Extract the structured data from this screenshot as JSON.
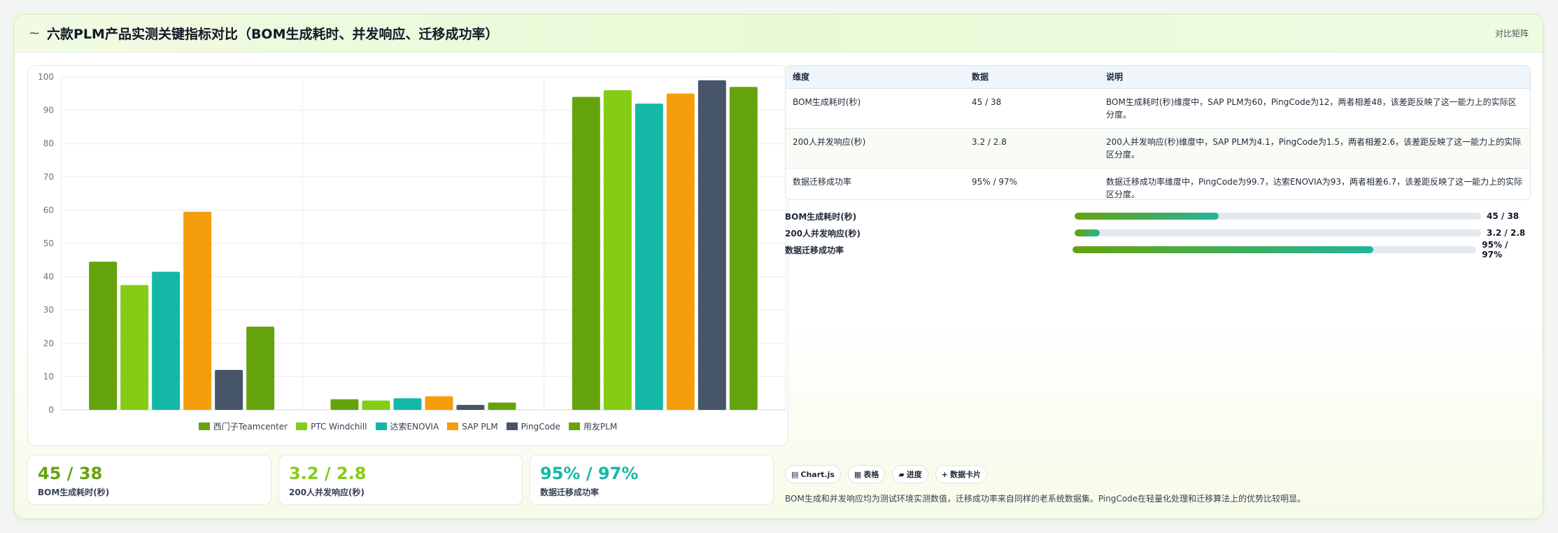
{
  "header": {
    "title": "六款PLM产品实测关键指标对比（BOM生成耗时、并发响应、迁移成功率）",
    "mode_label": "对比矩阵"
  },
  "colors": {
    "siemens": "#65a30d",
    "ptc": "#84cc16",
    "dassault": "#14b8a6",
    "sap": "#f59e0b",
    "pingcode": "#475569",
    "yonyou": "#65a30d"
  },
  "chart_data": {
    "type": "bar",
    "categories": [
      "BOM生成耗时(秒)",
      "200人并发响应(秒)",
      "数据迁移成功率"
    ],
    "ylim": [
      0,
      100
    ],
    "yticks": [
      0,
      10,
      20,
      30,
      40,
      50,
      60,
      70,
      80,
      90,
      100
    ],
    "grid": true,
    "legend_position": "bottom",
    "series": [
      {
        "name": "西门子Teamcenter",
        "color": "#65a30d",
        "values": [
          44.5,
          3.2,
          94
        ]
      },
      {
        "name": "PTC Windchill",
        "color": "#84cc16",
        "values": [
          37.5,
          2.8,
          96
        ]
      },
      {
        "name": "达索ENOVIA",
        "color": "#14b8a6",
        "values": [
          41.5,
          3.5,
          92
        ]
      },
      {
        "name": "SAP PLM",
        "color": "#f59e0b",
        "values": [
          59.5,
          4.1,
          95
        ]
      },
      {
        "name": "PingCode",
        "color": "#475569",
        "values": [
          12,
          1.5,
          99
        ]
      },
      {
        "name": "用友PLM",
        "color": "#65a30d",
        "values": [
          25,
          2.2,
          97
        ]
      }
    ]
  },
  "stats": [
    {
      "value": "45 / 38",
      "label": "BOM生成耗时(秒)",
      "color": "#65a30d"
    },
    {
      "value": "3.2 / 2.8",
      "label": "200人并发响应(秒)",
      "color": "#84cc16"
    },
    {
      "value": "95% / 97%",
      "label": "数据迁移成功率",
      "color": "#14b8a6"
    }
  ],
  "table": {
    "headers": [
      "维度",
      "数据",
      "说明"
    ],
    "rows": [
      [
        "BOM生成耗时(秒)",
        "45 / 38",
        "BOM生成耗时(秒)维度中，SAP PLM为60，PingCode为12，两者相差48，该差距反映了这一能力上的实际区分度。"
      ],
      [
        "200人并发响应(秒)",
        "3.2 / 2.8",
        "200人并发响应(秒)维度中，SAP PLM为4.1，PingCode为1.5，两者相差2.6，该差距反映了这一能力上的实际区分度。"
      ],
      [
        "数据迁移成功率",
        "95% / 97%",
        "数据迁移成功率维度中，PingCode为99.7，达索ENOVIA为93，两者相差6.7，该差距反映了这一能力上的实际区分度。"
      ]
    ]
  },
  "progress": [
    {
      "label": "BOM生成耗时(秒)",
      "value": "45 / 38",
      "fraction": 0.355
    },
    {
      "label": "200人并发响应(秒)",
      "value": "3.2 / 2.8",
      "fraction": 0.062
    },
    {
      "label": "数据迁移成功率",
      "value": "95% / 97%",
      "fraction": 0.745
    }
  ],
  "tags": [
    {
      "icon": "chart-icon",
      "glyph": "▤",
      "label": "Chart.js"
    },
    {
      "icon": "table-icon",
      "glyph": "▦",
      "label": "表格"
    },
    {
      "icon": "progress-icon",
      "glyph": "▰",
      "label": "进度"
    },
    {
      "icon": "plus-icon",
      "glyph": "+",
      "label": "数据卡片"
    }
  ],
  "note": "BOM生成和并发响应均为测试环境实测数值，迁移成功率来自同样的老系统数据集。PingCode在轻量化处理和迁移算法上的优势比较明显。"
}
